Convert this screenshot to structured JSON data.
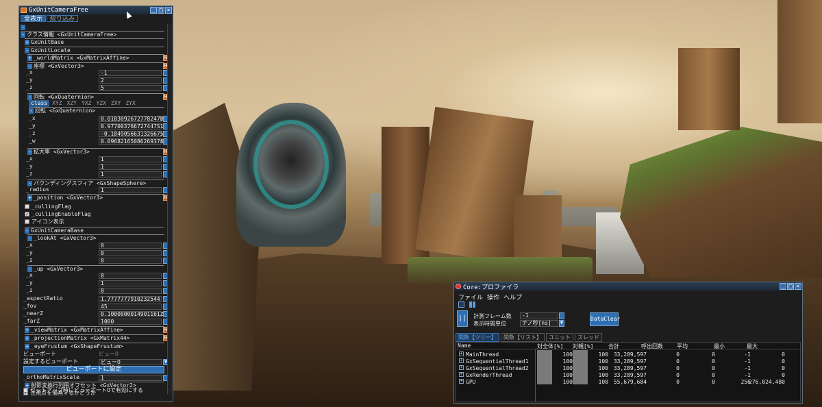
{
  "scene_icon": "game-3d-scene",
  "camera_window": {
    "title": "GxUnitCameraFree",
    "tabs": [
      "全表示",
      "絞り込み"
    ],
    "class_header": "クラス情報 <GxUnitCameraFree>",
    "unit_base": "GxUnitBase",
    "unit_locate": "GxUnitLocate",
    "world_matrix": "_worldMatrix <GxMatrixAffine>",
    "position": {
      "label": "座標 <GxVector3>",
      "x_label": "_x",
      "y_label": "_y",
      "z_label": "_z",
      "x": "-1",
      "y": "2",
      "z": "5"
    },
    "rotation": {
      "label": "回転 <GxQuaternion>",
      "tabs": [
        "class",
        "XYZ",
        "XZY",
        "YXZ",
        "YZX",
        "ZXY",
        "ZYX"
      ],
      "inner_label": "回転 <GxQuaternion>",
      "x_label": "_x",
      "y_label": "_y",
      "z_label": "_z",
      "w_label": "_w",
      "x": "0.0183092672778247B",
      "y": "0.977003766727447S1",
      "z": "-0.18490566313266754",
      "w": "0.096821650862693787"
    },
    "scale": {
      "label": "拡大率 <GxVector3>",
      "x_label": "_x",
      "y_label": "_y",
      "z_label": "_z",
      "x": "1",
      "y": "1",
      "z": "1"
    },
    "bounding": {
      "label": "バウンディングスフィア <GxShapeSphere>",
      "radius_label": "_radius",
      "radius": "1",
      "position_label": "_position <GxVector3>"
    },
    "culling_flag": "_cullingFlag",
    "culling_enable": "_cullingEnableFlag",
    "icon_display": "アイコン表示",
    "camera_base": "GxUnitCameraBase",
    "look_at": {
      "label": "_lookAt <GxVector3>",
      "x_label": "_x",
      "y_label": "_y",
      "z_label": "_z",
      "x": "0",
      "y": "0",
      "z": "0"
    },
    "up": {
      "label": "_up <GxVector3>",
      "x_label": "_x",
      "y_label": "_y",
      "z_label": "_z",
      "x": "0",
      "y": "1",
      "z": "0"
    },
    "aspect_label": "_aspectRatio",
    "aspect": "1.7777777910232544",
    "fov_label": "_fov",
    "fov": "45",
    "near_label": "_nearZ",
    "near": "0.1000000014901161Z",
    "far_label": "_farZ",
    "far": "1000",
    "view_matrix": "_viewMatrix <GxMatrixAffine>",
    "proj_matrix": "_projectionMatrix <GxMatrix44>",
    "eye_frustum": "_eyeFrustum <GxShapeFrustum>",
    "viewport_label": "ビューポート",
    "viewport_value": "ビューO",
    "set_viewport_label": "設定するビューポート",
    "set_viewport_value": "ビューO",
    "set_button": "ビューポートに設定",
    "ortho_label": "_orthoMatrixScale",
    "ortho_value": "1",
    "proj_offset": "射影変換行列用オフセット <GxVector2>",
    "draw_gaze": "注視点を描画するかどうか",
    "setup_viewport": "セットアップ時にビューポートOで有効にする"
  },
  "profiler": {
    "title": "Core:プロファイラ",
    "menu": [
      "ファイル",
      "操作",
      "ヘルプ"
    ],
    "frames_label": "計測フレーム数",
    "frames_value": "-1",
    "unit_label": "表示時間単位",
    "unit_value": "ナノ秒[ns]",
    "data_clear": "DataClear",
    "tabs": [
      "関数【ツリー】",
      "関数【リスト】",
      "ユニット",
      "スレッド"
    ],
    "columns": [
      "Name",
      "対全体[%]",
      "対親[%]",
      "合計",
      "呼出回数",
      "平均",
      "最小",
      "最大"
    ],
    "rows": [
      {
        "name": "MainThread",
        "total_pct": "100",
        "parent_pct": "100",
        "sum": "33,289,597",
        "calls": "0",
        "avg": "0",
        "min": "-1",
        "max": "0"
      },
      {
        "name": "GxSequentialThread1",
        "total_pct": "100",
        "parent_pct": "100",
        "sum": "33,289,597",
        "calls": "0",
        "avg": "0",
        "min": "-1",
        "max": "0"
      },
      {
        "name": "GxSequentialThread2",
        "total_pct": "100",
        "parent_pct": "100",
        "sum": "33,289,597",
        "calls": "0",
        "avg": "0",
        "min": "-1",
        "max": "0"
      },
      {
        "name": "GxRenderThread",
        "total_pct": "100",
        "parent_pct": "100",
        "sum": "33,289,597",
        "calls": "0",
        "avg": "0",
        "min": "-1",
        "max": "0"
      },
      {
        "name": "GPU",
        "total_pct": "100",
        "parent_pct": "100",
        "sum": "55,679,684",
        "calls": "0",
        "avg": "0",
        "min": "256",
        "max": "276,024,480"
      }
    ]
  }
}
